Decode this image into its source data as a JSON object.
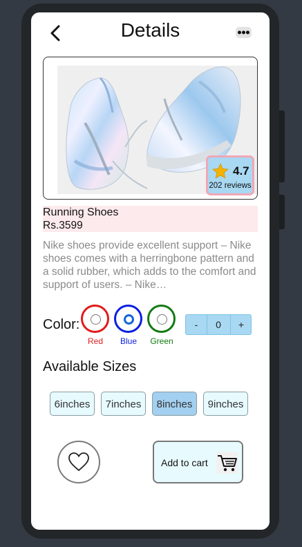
{
  "header": {
    "title": "Details",
    "back_icon": "chevron-left-icon",
    "menu_icon": "more-horizontal-icon"
  },
  "product": {
    "image_alt": "holographic sneakers",
    "rating": "4.7",
    "reviews": "202 reviews",
    "name": "Running Shoes",
    "price": "Rs.3599",
    "description": "Nike shoes provide excellent support – Nike shoes comes with a herringbone pattern and a solid rubber, which adds to the comfort and support of users. – Nike…"
  },
  "color": {
    "label": "Color:",
    "options": [
      {
        "name": "Red",
        "hex": "#e01b1b",
        "selected": false
      },
      {
        "name": "Blue",
        "hex": "#0a1ee0",
        "selected": true
      },
      {
        "name": "Green",
        "hex": "#127a12",
        "selected": false
      }
    ]
  },
  "quantity": {
    "minus": "-",
    "value": "0",
    "plus": "+"
  },
  "sizes": {
    "label": "Available Sizes",
    "options": [
      {
        "label": "6inches",
        "selected": false
      },
      {
        "label": "7inches",
        "selected": false
      },
      {
        "label": "8inches",
        "selected": true
      },
      {
        "label": "9inches",
        "selected": false
      }
    ]
  },
  "actions": {
    "favorite_icon": "heart-icon",
    "add_to_cart": "Add to cart",
    "cart_icon": "cart-icon"
  },
  "colors": {
    "accent_blue": "#a8d8f2",
    "highlight_pink": "#fdeaec"
  }
}
